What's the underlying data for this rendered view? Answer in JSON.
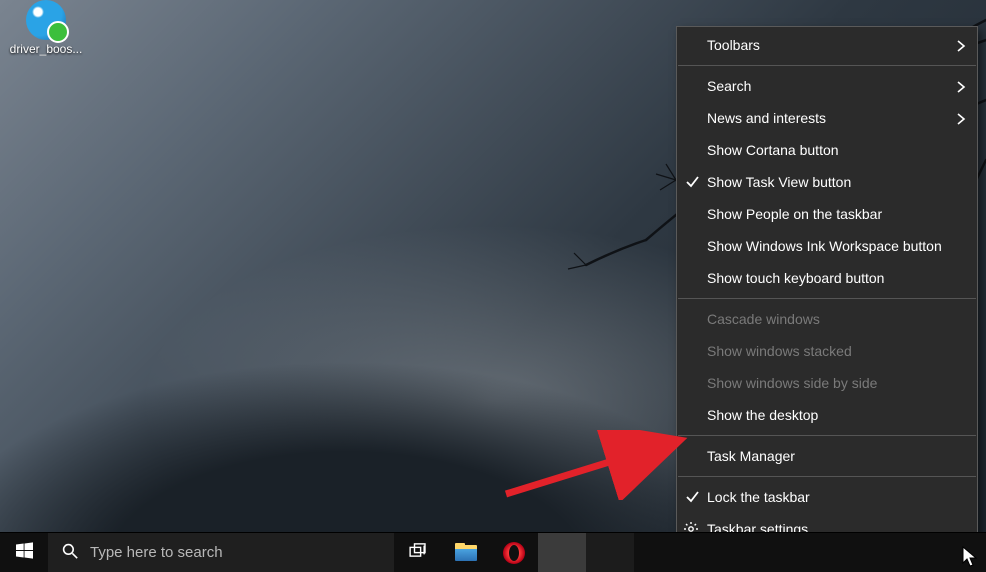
{
  "desktop": {
    "icons": [
      {
        "name": "driver-booster",
        "label": "driver_boos..."
      }
    ]
  },
  "taskbar": {
    "search_placeholder": "Type here to search"
  },
  "context_menu": {
    "items": [
      {
        "label": "Toolbars",
        "submenu": true,
        "enabled": true,
        "checked": false
      },
      {
        "separator": true
      },
      {
        "label": "Search",
        "submenu": true,
        "enabled": true,
        "checked": false
      },
      {
        "label": "News and interests",
        "submenu": true,
        "enabled": true,
        "checked": false
      },
      {
        "label": "Show Cortana button",
        "enabled": true,
        "checked": false
      },
      {
        "label": "Show Task View button",
        "enabled": true,
        "checked": true
      },
      {
        "label": "Show People on the taskbar",
        "enabled": true,
        "checked": false
      },
      {
        "label": "Show Windows Ink Workspace button",
        "enabled": true,
        "checked": false
      },
      {
        "label": "Show touch keyboard button",
        "enabled": true,
        "checked": false
      },
      {
        "separator": true
      },
      {
        "label": "Cascade windows",
        "enabled": false,
        "checked": false
      },
      {
        "label": "Show windows stacked",
        "enabled": false,
        "checked": false
      },
      {
        "label": "Show windows side by side",
        "enabled": false,
        "checked": false
      },
      {
        "label": "Show the desktop",
        "enabled": true,
        "checked": false
      },
      {
        "separator": true
      },
      {
        "label": "Task Manager",
        "enabled": true,
        "checked": false
      },
      {
        "separator": true
      },
      {
        "label": "Lock the taskbar",
        "enabled": true,
        "checked": true
      },
      {
        "label": "Taskbar settings",
        "enabled": true,
        "checked": false,
        "icon": "gear"
      }
    ]
  }
}
